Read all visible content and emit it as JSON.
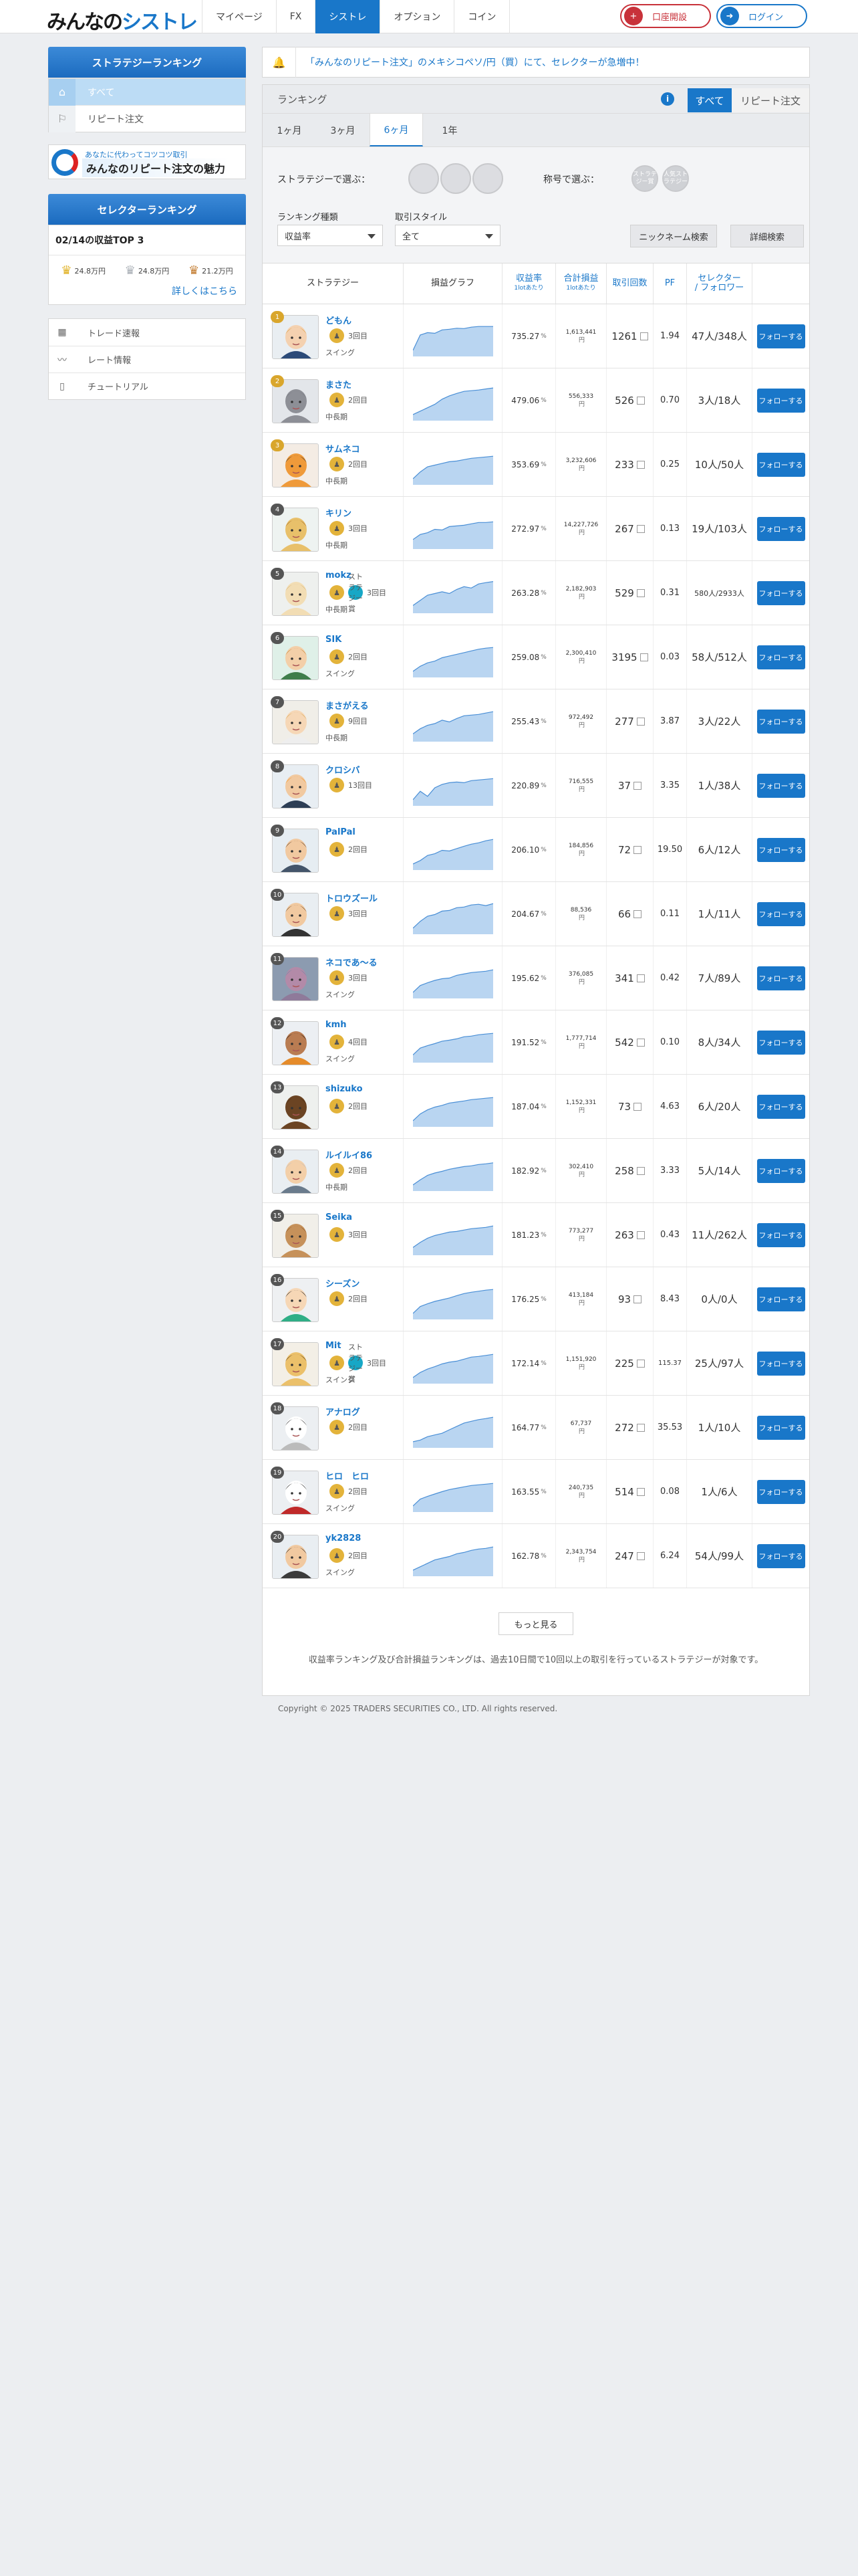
{
  "header": {
    "logo_left": "みんなの",
    "logo_right": "シストレ",
    "nav": [
      "マイページ",
      "FX",
      "シストレ",
      "オプション",
      "コイン"
    ],
    "nav_active": 2,
    "open_account": "口座開設",
    "login": "ログイン"
  },
  "sidebar": {
    "strategy_title": "ストラテジーランキング",
    "strategy_items": [
      {
        "label": "すべて",
        "icon": "home-icon",
        "selected": true
      },
      {
        "label": "リピート注文",
        "icon": "flag-icon",
        "selected": false
      }
    ],
    "banner_line1": "あなたに代わってコツコツ取引",
    "banner_line2": "みんなのリピート注文の魅力",
    "selector_title": "セレクターランキング",
    "selector_date": "02/14の収益TOP 3",
    "top3": [
      {
        "medal": "gold",
        "value": "24.8万円"
      },
      {
        "medal": "silver",
        "value": "24.8万円"
      },
      {
        "medal": "bronze",
        "value": "21.2万円"
      }
    ],
    "selector_more": "詳しくはこちら",
    "links": [
      {
        "label": "トレード速報",
        "icon": "calculator-icon"
      },
      {
        "label": "レート情報",
        "icon": "chart-line-icon"
      },
      {
        "label": "チュートリアル",
        "icon": "book-icon"
      }
    ]
  },
  "notice": {
    "text": "「みんなのリピート注文」のメキシコペソ/円（買）にて、セレクターが急増中！"
  },
  "ranking": {
    "title": "ランキング",
    "tabs": [
      "すべて",
      "リピート注文"
    ],
    "periods": [
      "1ヶ月",
      "3ヶ月",
      "6ヶ月",
      "1年"
    ],
    "period_active": 2,
    "filter_strategy_label": "ストラテジーで選ぶ：",
    "filter_title_label": "称号で選ぶ：",
    "title_badges": [
      "ストラテジー賞",
      "人気ストラテジー"
    ],
    "type_label": "ランキング種類",
    "type_value": "収益率",
    "style_label": "取引スタイル",
    "style_value": "全て",
    "nickname_search": "ニックネーム検索",
    "detail_search": "詳細検索"
  },
  "table": {
    "headers": {
      "strategy": "ストラテジー",
      "graph": "損益グラフ",
      "return_rate": "収益率",
      "return_sub": "1lotあたり",
      "profit": "合計損益",
      "profit_sub": "1lotあたり",
      "trades": "取引回数",
      "pf": "PF",
      "selector": "セレクター",
      "selector_sub": "/ フォロワー"
    },
    "follow_label": "フォローする",
    "rows": [
      {
        "rank": "1",
        "name": "どもん",
        "medal": "3回目",
        "style": "スイング",
        "rate": "735.27",
        "profit": "1,613,441",
        "trades": "1261",
        "pf": "1.94",
        "sel": "47人/348人",
        "avatar": "man-suit"
      },
      {
        "rank": "2",
        "name": "まさた",
        "medal": "2回目",
        "style": "中長期",
        "rate": "479.06",
        "profit": "556,333",
        "trades": "526",
        "pf": "0.70",
        "sel": "3人/18人",
        "avatar": "elephant"
      },
      {
        "rank": "3",
        "name": "サムネコ",
        "medal": "2回目",
        "style": "中長期",
        "rate": "353.69",
        "profit": "3,232,606",
        "trades": "233",
        "pf": "0.25",
        "sel": "10人/50人",
        "avatar": "tiger"
      },
      {
        "rank": "4",
        "name": "キリン",
        "medal": "3回目",
        "style": "中長期",
        "rate": "272.97",
        "profit": "14,227,726",
        "trades": "267",
        "pf": "0.13",
        "sel": "19人/103人",
        "avatar": "giraffe"
      },
      {
        "rank": "5",
        "name": "mokz",
        "medal": "3回目",
        "medal2": "ストラテジー賞",
        "style": "中長期",
        "rate": "263.28",
        "profit": "2,182,903",
        "trades": "529",
        "pf": "0.31",
        "sel": "580人/2933人",
        "avatar": "cat"
      },
      {
        "rank": "6",
        "name": "SIK",
        "medal": "2回目",
        "style": "スイング",
        "rate": "259.08",
        "profit": "2,300,410",
        "trades": "3195",
        "pf": "0.03",
        "sel": "58人/512人",
        "avatar": "man-glasses"
      },
      {
        "rank": "7",
        "name": "まさがえる",
        "medal": "9回目",
        "style": "中長期",
        "rate": "255.43",
        "profit": "972,492",
        "trades": "277",
        "pf": "3.87",
        "sel": "3人/22人",
        "avatar": "boy"
      },
      {
        "rank": "8",
        "name": "クロシバ",
        "medal": "13回目",
        "style": "",
        "rate": "220.89",
        "profit": "716,555",
        "trades": "37",
        "pf": "3.35",
        "sel": "1人/38人",
        "avatar": "worker"
      },
      {
        "rank": "9",
        "name": "PalPal",
        "medal": "2回目",
        "style": "",
        "rate": "206.10",
        "profit": "184,856",
        "trades": "72",
        "pf": "19.50",
        "sel": "6人/12人",
        "avatar": "man-brown"
      },
      {
        "rank": "10",
        "name": "トロウズール",
        "medal": "3回目",
        "style": "",
        "rate": "204.67",
        "profit": "88,536",
        "trades": "66",
        "pf": "0.11",
        "sel": "1人/11人",
        "avatar": "man-tie"
      },
      {
        "rank": "11",
        "name": "ネコであ～る",
        "medal": "3回目",
        "style": "スイング",
        "rate": "195.62",
        "profit": "376,085",
        "trades": "341",
        "pf": "0.42",
        "sel": "7人/89人",
        "avatar": "photo"
      },
      {
        "rank": "12",
        "name": "kmh",
        "medal": "4回目",
        "style": "スイング",
        "rate": "191.52",
        "profit": "1,777,714",
        "trades": "542",
        "pf": "0.10",
        "sel": "8人/34人",
        "avatar": "woman"
      },
      {
        "rank": "13",
        "name": "shizuko",
        "medal": "2回目",
        "style": "",
        "rate": "187.04",
        "profit": "1,152,331",
        "trades": "73",
        "pf": "4.63",
        "sel": "6人/20人",
        "avatar": "bear"
      },
      {
        "rank": "14",
        "name": "ルイルイ86",
        "medal": "2回目",
        "style": "中長期",
        "rate": "182.92",
        "profit": "302,410",
        "trades": "258",
        "pf": "3.33",
        "sel": "5人/14人",
        "avatar": "old-man"
      },
      {
        "rank": "15",
        "name": "Seika",
        "medal": "3回目",
        "style": "",
        "rate": "181.23",
        "profit": "773,277",
        "trades": "263",
        "pf": "0.43",
        "sel": "11人/262人",
        "avatar": "deer"
      },
      {
        "rank": "16",
        "name": "シーズン",
        "medal": "2回目",
        "style": "",
        "rate": "176.25",
        "profit": "413,184",
        "trades": "93",
        "pf": "8.43",
        "sel": "0人/0人",
        "avatar": "girl"
      },
      {
        "rank": "17",
        "name": "Mit",
        "medal": "3回目",
        "medal2": "ストラテジー賞",
        "style": "スイング",
        "rate": "172.14",
        "profit": "1,151,920",
        "trades": "225",
        "pf": "115.37",
        "sel": "25人/97人",
        "avatar": "leopard"
      },
      {
        "rank": "18",
        "name": "アナログ",
        "medal": "2回目",
        "style": "",
        "rate": "164.77",
        "profit": "67,737",
        "trades": "272",
        "pf": "35.53",
        "sel": "1人/10人",
        "avatar": "bus"
      },
      {
        "rank": "19",
        "name": "ヒロ　ヒロ",
        "medal": "2回目",
        "style": "スイング",
        "rate": "163.55",
        "profit": "240,735",
        "trades": "514",
        "pf": "0.08",
        "sel": "1人/6人",
        "avatar": "robot"
      },
      {
        "rank": "20",
        "name": "yk2828",
        "medal": "2回目",
        "style": "スイング",
        "rate": "162.78",
        "profit": "2,343,754",
        "trades": "247",
        "pf": "6.24",
        "sel": "54人/99人",
        "avatar": "man-beard"
      }
    ],
    "percent_unit": "%",
    "yen_unit": "円",
    "more_label": "もっと見る",
    "note": "収益率ランキング及び合計損益ランキングは、過去10日間で10回以上の取引を行っているストラテジーが対象です。"
  },
  "footer": "Copyright © 2025 TRADERS SECURITIES CO., LTD. All rights reserved.",
  "colors": {
    "primary": "#1977c9",
    "accent_red": "#c8323a",
    "graph_fill": "#b9d5f1",
    "graph_line": "#4a8fd6"
  }
}
